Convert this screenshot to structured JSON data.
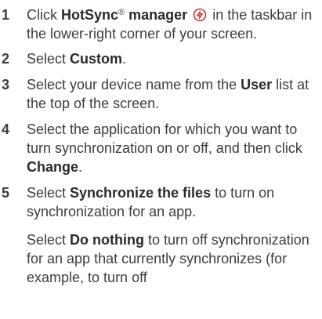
{
  "steps": [
    {
      "number": "1",
      "parts": {
        "pre": "Click ",
        "bold": "HotSync",
        "reg": "®",
        "bold2": " manager",
        "post": " in the taskbar in the lower-right corner of your screen."
      },
      "icon": "hotsync-icon"
    },
    {
      "number": "2",
      "parts": {
        "pre": "Select ",
        "bold": "Custom",
        "post": "."
      }
    },
    {
      "number": "3",
      "parts": {
        "pre": "Select your device name from the ",
        "bold": "User",
        "post": " list at the top of the screen."
      }
    },
    {
      "number": "4",
      "parts": {
        "pre": "Select the application for which you want to turn synchronization on or off, and then click ",
        "bold": "Change",
        "post": "."
      }
    },
    {
      "number": "5",
      "parts": {
        "pre": "Select ",
        "bold": "Synchronize the files",
        "post": " to turn on synchronization for an app."
      }
    }
  ],
  "substep": {
    "pre": "Select ",
    "bold": "Do nothing",
    "post": " to turn off synchronization for an app that currently synchronizes (for example, to turn off"
  },
  "colors": {
    "text": "#3d3d3d",
    "icon_stroke": "#c0392b"
  }
}
